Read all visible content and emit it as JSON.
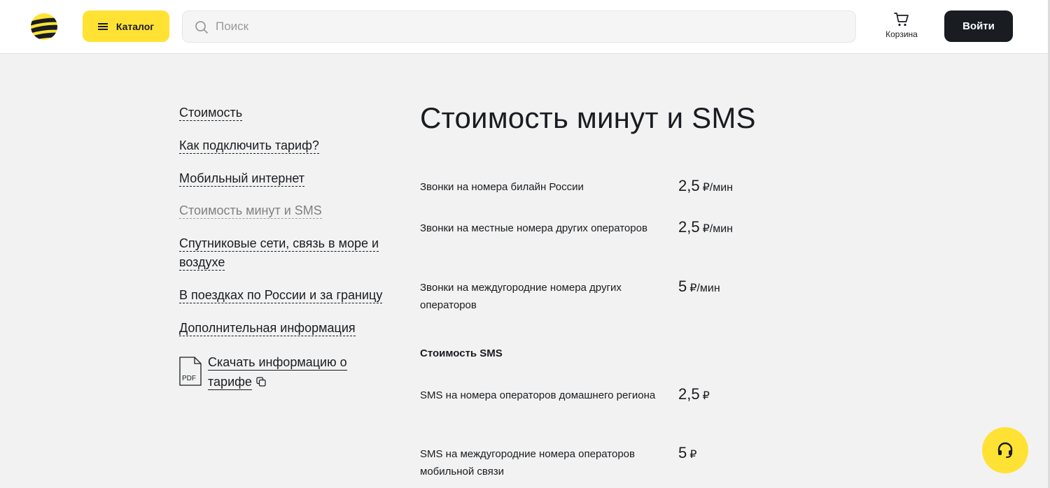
{
  "header": {
    "catalog_label": "Каталог",
    "search_placeholder": "Поиск",
    "cart_label": "Корзина",
    "login_label": "Войти"
  },
  "sidenav": {
    "items": [
      {
        "label": "Стоимость"
      },
      {
        "label": "Как подключить тариф?"
      },
      {
        "label": "Мобильный интернет"
      },
      {
        "label": "Стоимость минут и SMS",
        "active": true
      },
      {
        "label": "Спутниковые сети, связь в море и воздухе"
      },
      {
        "label": "В поездках по России и за границу"
      },
      {
        "label": "Дополнительная информация"
      }
    ],
    "pdf_icon_label": "PDF",
    "download_label": "Скачать информацию о тарифе"
  },
  "main": {
    "title": "Стоимость минут и SMS",
    "calls": [
      {
        "label": "Звонки на номера билайн России",
        "price": "2,5",
        "unit": "₽/мин"
      },
      {
        "label": "Звонки на местные номера других операторов",
        "price": "2,5",
        "unit": "₽/мин"
      },
      {
        "label": "Звонки на междугородние номера других операторов",
        "price": "5",
        "unit": "₽/мин"
      }
    ],
    "sms_heading": "Стоимость SMS",
    "sms": [
      {
        "label": "SMS на номера операторов домашнего региона",
        "price": "2,5",
        "unit": "₽"
      },
      {
        "label": "SMS на междугородние номера операторов мобильной связи",
        "price": "5",
        "unit": "₽"
      }
    ]
  },
  "colors": {
    "brand_yellow": "#ffe234",
    "text_dark": "#191c20",
    "page_bg": "#f2f2f2"
  },
  "icons": {
    "logo": "beeline-logo",
    "catalog": "burger-menu-icon",
    "search": "search-icon",
    "cart": "cart-icon",
    "pdf": "pdf-file-icon",
    "copy": "copy-icon",
    "support": "headset-icon"
  }
}
